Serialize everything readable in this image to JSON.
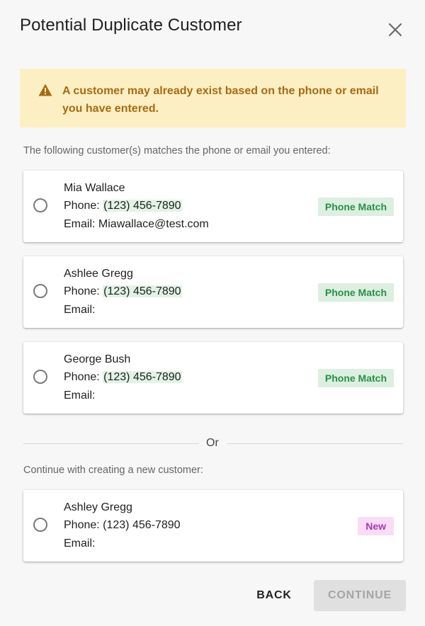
{
  "dialog": {
    "title": "Potential Duplicate Customer"
  },
  "alert": {
    "message": "A customer may already exist based on the phone or email you have entered."
  },
  "matches": {
    "intro": "The following customer(s) matches the phone or email you entered:",
    "phone_prefix": "Phone: ",
    "email_prefix": "Email: ",
    "items": [
      {
        "name": "Mia Wallace",
        "phone": "(123) 456-7890",
        "email": "Miawallace@test.com",
        "badge": "Phone Match"
      },
      {
        "name": "Ashlee Gregg",
        "phone": "(123) 456-7890",
        "email": "",
        "badge": "Phone Match"
      },
      {
        "name": "George Bush",
        "phone": "(123) 456-7890",
        "email": "",
        "badge": "Phone Match"
      }
    ]
  },
  "divider": {
    "text": "Or"
  },
  "new_customer": {
    "intro": "Continue with creating a new customer:",
    "name": "Ashley Gregg",
    "phone": "(123) 456-7890",
    "email": "",
    "badge": "New"
  },
  "footer": {
    "back_label": "BACK",
    "continue_label": "CONTINUE"
  },
  "icons": {
    "close": "close-icon",
    "warning": "warning-icon",
    "radio": "radio-unchecked-icon"
  },
  "colors": {
    "alert_bg": "#fdefc4",
    "alert_text": "#a66a14",
    "match_badge_bg": "#dcefe0",
    "match_badge_text": "#2a8f48",
    "new_badge_bg": "#fbdcf6",
    "new_badge_text": "#a43bb0",
    "phone_highlight": "#e2f3e6",
    "disabled_button_bg": "#e0e0e0"
  }
}
